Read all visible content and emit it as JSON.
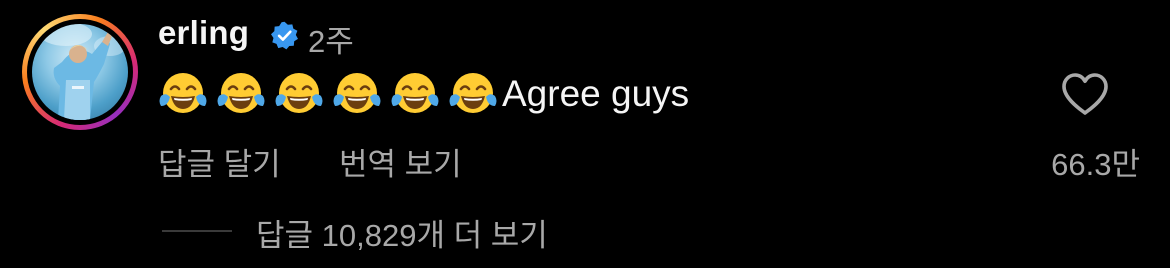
{
  "comment": {
    "username": "erling",
    "verified_icon": "verified-badge-icon",
    "timestamp": "2주",
    "emoji": "😂",
    "emoji_count": 6,
    "text": "Agree guys",
    "actions": {
      "reply_label": "답글 달기",
      "translate_label": "번역 보기"
    },
    "like_icon": "heart-outline-icon",
    "likes": "66.3만",
    "view_replies_label": "답글 10,829개 더 보기"
  },
  "colors": {
    "background": "#000000",
    "primary_text": "#f5f5f5",
    "secondary_text": "#a8a8a8",
    "verified_blue": "#3897f0"
  }
}
